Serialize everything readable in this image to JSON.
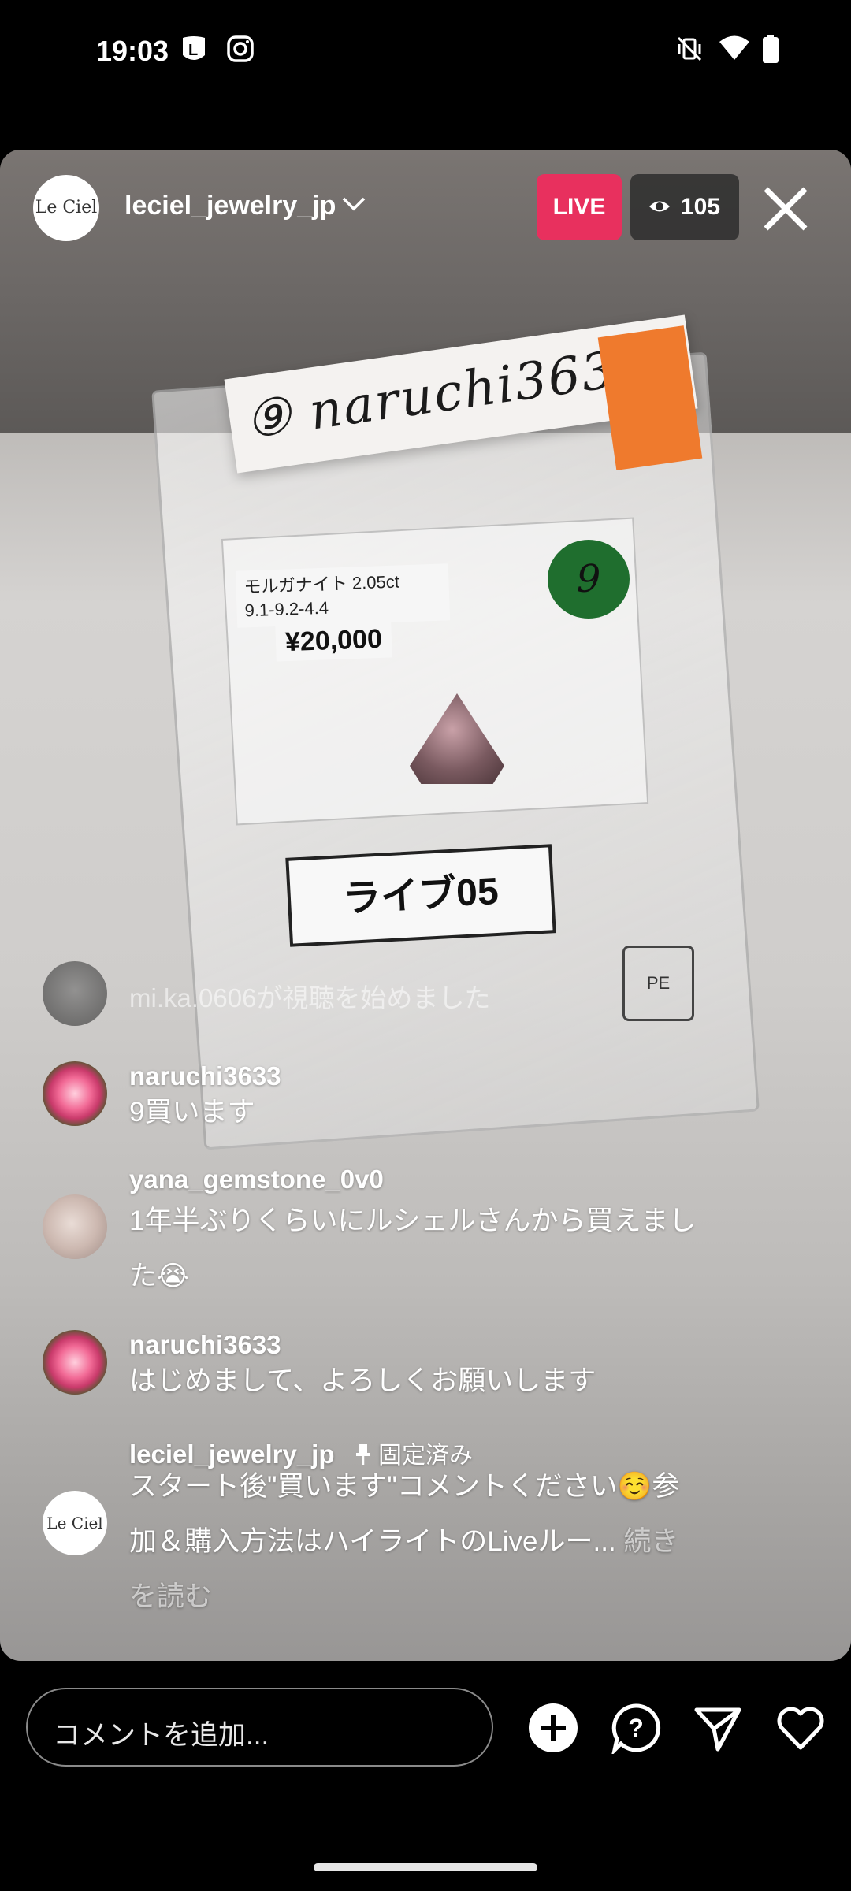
{
  "status_bar": {
    "time": "19:03",
    "left_icons": [
      "line-app-icon",
      "instagram-icon"
    ],
    "right_icons": [
      "vibrate-off-icon",
      "wifi-icon",
      "battery-icon"
    ]
  },
  "live": {
    "host_username": "leciel_jewelry_jp",
    "avatar_text": "Le Ciel",
    "live_badge": "LIVE",
    "viewer_count": "105"
  },
  "video_scene": {
    "handwritten_label": "⑨ naruchi3633",
    "spec_line1": "モルガナイト 2.05ct",
    "spec_line2": "9.1-9.2-4.4",
    "price": "¥20,000",
    "green_sticker_number": "9",
    "card_text": "ライブ05",
    "recycle_mark": "PE"
  },
  "comments": [
    {
      "type": "joined",
      "text": "mi.ka.0606が視聴を始めました"
    },
    {
      "type": "comment",
      "user": "naruchi3633",
      "text": "9買います"
    },
    {
      "type": "comment",
      "user": "yana_gemstone_0v0",
      "text": "1年半ぶりくらいにルシェルさんから買えました😭"
    },
    {
      "type": "comment",
      "user": "naruchi3633",
      "text": "はじめまして、よろしくお願いします"
    },
    {
      "type": "pinned",
      "user": "leciel_jewelry_jp",
      "pin_label": "固定済み",
      "text_line1": "スタート後\"買います\"コメントください☺️参",
      "text_line2": "加＆購入方法はハイライトのLiveルー...",
      "read_more_1": "続き",
      "read_more_2": "を読む"
    }
  ],
  "bottom_bar": {
    "comment_placeholder": "コメントを追加...",
    "icons": [
      "add-icon",
      "question-icon",
      "send-icon",
      "heart-icon"
    ]
  }
}
